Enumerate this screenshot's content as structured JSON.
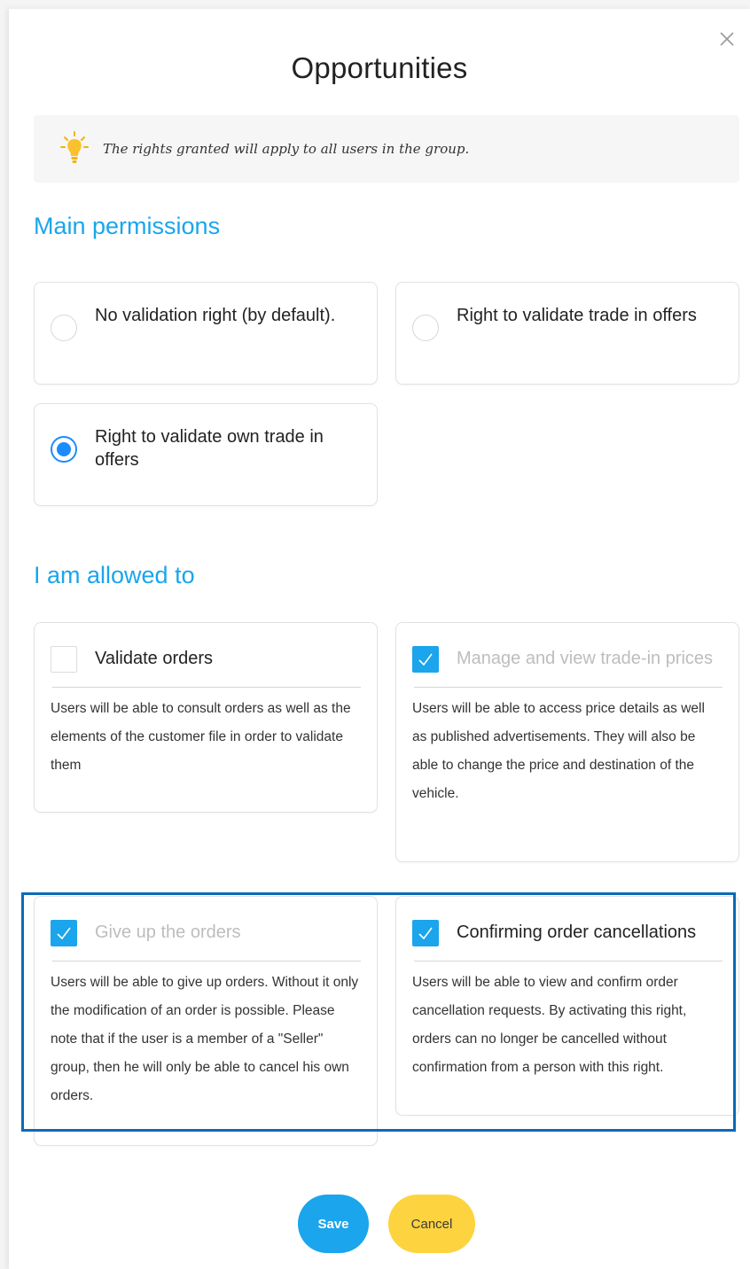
{
  "dialog": {
    "title": "Opportunities",
    "info_text": "The rights granted will apply to all users in the group."
  },
  "main_permissions": {
    "heading": "Main permissions",
    "options": [
      {
        "label": "No validation right (by default).",
        "selected": false
      },
      {
        "label": "Right to validate trade in offers",
        "selected": false
      },
      {
        "label": "Right to validate own trade in offers",
        "selected": true
      }
    ]
  },
  "allowed": {
    "heading": "I am allowed to",
    "items": [
      {
        "label": "Validate orders",
        "checked": false,
        "disabled": false,
        "description": "Users will be able to consult orders as well as the elements of the customer file in order to validate them"
      },
      {
        "label": "Manage and view trade-in prices",
        "checked": true,
        "disabled": true,
        "description": "Users will be able to access price details as well as published advertisements. They will also be able to change the price and destination of the vehicle."
      },
      {
        "label": "Give up the orders",
        "checked": true,
        "disabled": true,
        "description": "Users will be able to give up orders. Without it only the modification of an order is possible. Please note that if the user is a member of a \"Seller\" group, then he will only be able to cancel his own orders."
      },
      {
        "label": "Confirming order cancellations",
        "checked": true,
        "disabled": false,
        "description": "Users will be able to view and confirm order cancellation requests. By activating this right, orders can no longer be cancelled without confirmation from a person with this right."
      }
    ]
  },
  "buttons": {
    "save": "Save",
    "cancel": "Cancel"
  },
  "colors": {
    "accent": "#1aa5ec",
    "radio_selected": "#1a8cff",
    "cancel_button": "#fdd33f",
    "highlight_border": "#0a6ab8"
  }
}
